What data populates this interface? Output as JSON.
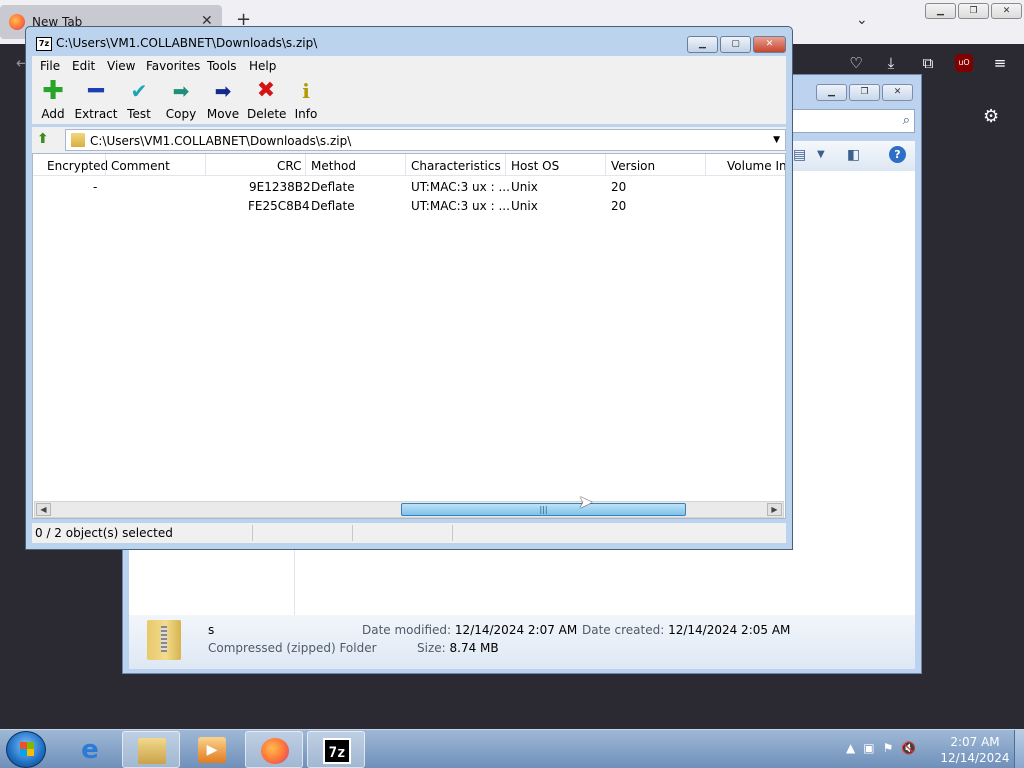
{
  "browser": {
    "tab_label": "New Tab",
    "tab_close": "✕",
    "new_tab": "+",
    "list_all_tabs": "⌄"
  },
  "explorer": {
    "details": {
      "name": "s",
      "type": "Compressed (zipped) Folder",
      "date_modified_label": "Date modified:",
      "date_modified": "12/14/2024 2:07 AM",
      "size_label": "Size:",
      "size": "8.74 MB",
      "date_created_label": "Date created:",
      "date_created": "12/14/2024 2:05 AM"
    }
  },
  "sevenzip": {
    "icon_text": "7z",
    "title": "C:\\Users\\VM1.COLLABNET\\Downloads\\s.zip\\",
    "menu": [
      "File",
      "Edit",
      "View",
      "Favorites",
      "Tools",
      "Help"
    ],
    "toolbar": [
      {
        "label": "Add",
        "icon": "plus-icon"
      },
      {
        "label": "Extract",
        "icon": "minus-icon"
      },
      {
        "label": "Test",
        "icon": "check-icon"
      },
      {
        "label": "Copy",
        "icon": "double-arrow-icon"
      },
      {
        "label": "Move",
        "icon": "arrow-right-icon"
      },
      {
        "label": "Delete",
        "icon": "x-icon"
      },
      {
        "label": "Info",
        "icon": "info-icon"
      }
    ],
    "address": "C:\\Users\\VM1.COLLABNET\\Downloads\\s.zip\\",
    "columns": [
      "Encrypted",
      "Comment",
      "CRC",
      "Method",
      "Characteristics",
      "Host OS",
      "Version",
      "Volume In"
    ],
    "rows": [
      {
        "encrypted": "-",
        "comment": "",
        "crc": "9E1238B2",
        "method": "Deflate",
        "characteristics": "UT:MAC:3 ux : ...",
        "host_os": "Unix",
        "version": "20"
      },
      {
        "encrypted": "",
        "comment": "",
        "crc": "FE25C8B4",
        "method": "Deflate",
        "characteristics": "UT:MAC:3 ux : ...",
        "host_os": "Unix",
        "version": "20"
      }
    ],
    "status": "0 / 2 object(s) selected"
  },
  "taskbar": {
    "sevenzip_label": "7z",
    "time": "2:07 AM",
    "date": "12/14/2024"
  }
}
